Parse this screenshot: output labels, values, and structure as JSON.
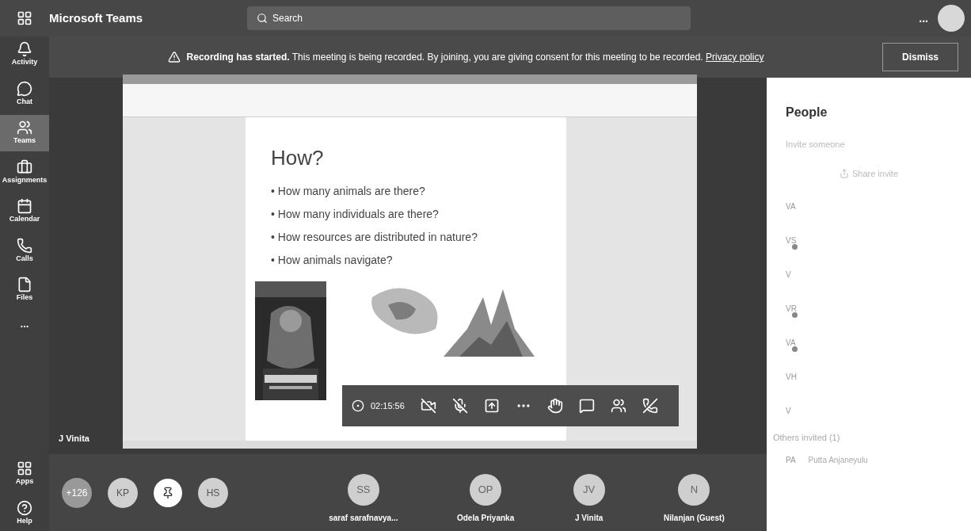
{
  "app_bar": {
    "title": "Microsoft Teams",
    "search": {
      "placeholder": "Search"
    },
    "more": "..."
  },
  "rail": [
    {
      "label": "Activity",
      "kind": "bell",
      "selected": false
    },
    {
      "label": "Chat",
      "kind": "chat",
      "selected": false
    },
    {
      "label": "Teams",
      "kind": "teams",
      "selected": true
    },
    {
      "label": "Assignments",
      "kind": "bag",
      "selected": false
    },
    {
      "label": "Calendar",
      "kind": "calendar",
      "selected": false
    },
    {
      "label": "Calls",
      "kind": "phone",
      "selected": false
    },
    {
      "label": "Files",
      "kind": "file",
      "selected": false
    },
    {
      "label": "...",
      "kind": "more",
      "selected": false
    }
  ],
  "rail_bottom": [
    {
      "label": "Apps",
      "kind": "apps",
      "selected": false
    },
    {
      "label": "Help",
      "kind": "help",
      "selected": false
    }
  ],
  "banner": {
    "bold": "Recording has started.",
    "text": "This meeting is being recorded. By joining, you are giving consent for this meeting to be recorded.",
    "link": "Privacy policy",
    "button": "Dismiss"
  },
  "slide": {
    "title": "How?",
    "bullets": [
      "• How many animals are there?",
      "• How many individuals are there?",
      "• How resources are distributed in nature?",
      "• How animals navigate?"
    ]
  },
  "stage_name": "J Vinita",
  "call_bar": {
    "timer": "02:15:56"
  },
  "participants": [
    {
      "initials": "+126",
      "kind": "count"
    },
    {
      "initials": "KP",
      "kind": "avatar"
    },
    {
      "kind": "pin"
    },
    {
      "initials": "HS",
      "kind": "avatar"
    }
  ],
  "tiles": [
    {
      "initials": "SS",
      "name": "saraf sarafnavya..."
    },
    {
      "initials": "OP",
      "name": "Odela Priyanka"
    },
    {
      "initials": "JV",
      "name": "J Vinita"
    },
    {
      "initials": "N",
      "name": "Nilanjan (Guest)"
    }
  ],
  "people": {
    "title": "People",
    "invite": "Invite someone",
    "share": "Share invite",
    "members": [
      {
        "initials": "VA",
        "online": false
      },
      {
        "initials": "VS",
        "online": true
      },
      {
        "initials": "V",
        "online": false
      },
      {
        "initials": "VR",
        "online": true
      },
      {
        "initials": "VA",
        "online": true
      },
      {
        "initials": "VH",
        "online": false
      },
      {
        "initials": "V",
        "online": false
      }
    ],
    "others_header": "Others invited (1)",
    "others": [
      {
        "initials": "PA",
        "name": "Putta Anjaneyulu"
      }
    ]
  }
}
